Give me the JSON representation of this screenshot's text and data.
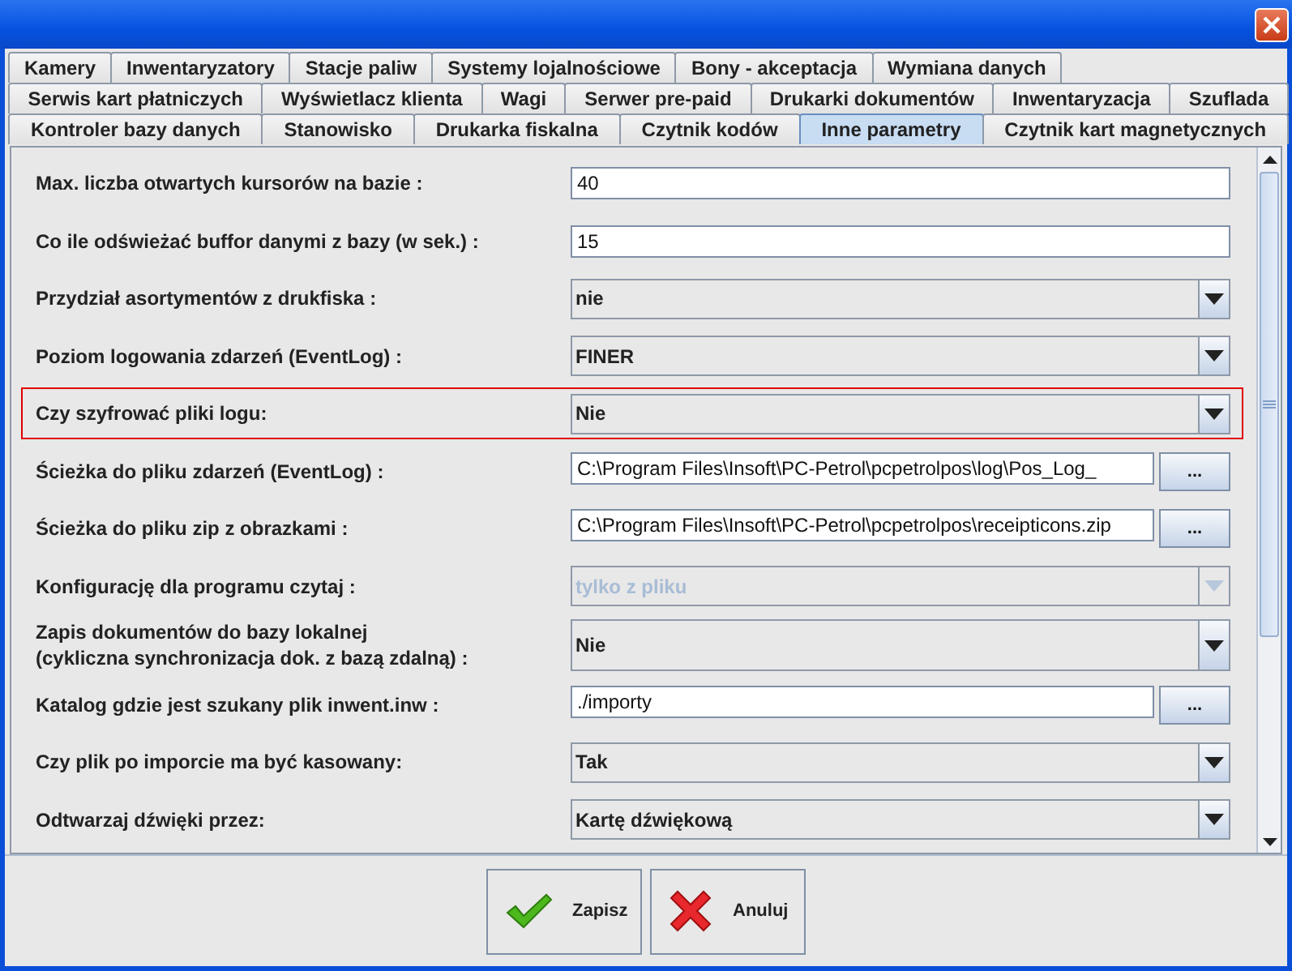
{
  "tab_rows": [
    [
      {
        "label": "Kamery",
        "selected": false
      },
      {
        "label": "Inwentaryzatory",
        "selected": false
      },
      {
        "label": "Stacje paliw",
        "selected": false
      },
      {
        "label": "Systemy lojalnościowe",
        "selected": false
      },
      {
        "label": "Bony - akceptacja",
        "selected": false
      },
      {
        "label": "Wymiana danych",
        "selected": false
      }
    ],
    [
      {
        "label": "Serwis kart płatniczych",
        "selected": false
      },
      {
        "label": "Wyświetlacz klienta",
        "selected": false
      },
      {
        "label": "Wagi",
        "selected": false
      },
      {
        "label": "Serwer pre-paid",
        "selected": false
      },
      {
        "label": "Drukarki dokumentów",
        "selected": false
      },
      {
        "label": "Inwentaryzacja",
        "selected": false
      },
      {
        "label": "Szuflada",
        "selected": false
      }
    ],
    [
      {
        "label": "Kontroler bazy danych",
        "selected": false
      },
      {
        "label": "Stanowisko",
        "selected": false
      },
      {
        "label": "Drukarka fiskalna",
        "selected": false
      },
      {
        "label": "Czytnik kodów",
        "selected": false
      },
      {
        "label": "Inne parametry",
        "selected": true
      },
      {
        "label": "Czytnik kart magnetycznych",
        "selected": false
      }
    ]
  ],
  "settings": [
    {
      "kind": "text",
      "label": "Max. liczba otwartych kursorów na bazie :",
      "value": "40",
      "focused": false
    },
    {
      "kind": "text",
      "label": "Co ile odświeżać buffor danymi z bazy (w sek.) :",
      "value": "15",
      "focused": false
    },
    {
      "kind": "combo",
      "label": "Przydział asortymentów z drukfiska :",
      "value": "nie",
      "disabled": false,
      "focused": false
    },
    {
      "kind": "combo",
      "label": "Poziom logowania zdarzeń (EventLog) :",
      "value": "FINER",
      "disabled": false,
      "focused": false
    },
    {
      "kind": "combo",
      "label": "Czy szyfrować pliki logu:",
      "value": "Nie",
      "disabled": false,
      "focused": true
    },
    {
      "kind": "path",
      "label": "Ścieżka do pliku zdarzeń (EventLog) :",
      "value": "C:\\Program Files\\Insoft\\PC-Petrol\\pcpetrolpos\\log\\Pos_Log_",
      "button": "...",
      "focused": false
    },
    {
      "kind": "path",
      "label": "Ścieżka do pliku zip z obrazkami :",
      "value": "C:\\Program Files\\Insoft\\PC-Petrol\\pcpetrolpos\\receipticons.zip",
      "button": "...",
      "focused": false
    },
    {
      "kind": "combo",
      "label": "Konfigurację dla programu czytaj :",
      "value": "tylko z pliku",
      "disabled": true,
      "focused": false
    },
    {
      "kind": "combo",
      "label": "Zapis dokumentów do bazy lokalnej\n(cykliczna synchronizacja dok. z bazą zdalną) :",
      "value": "Nie",
      "disabled": false,
      "focused": false
    },
    {
      "kind": "path",
      "label": "Katalog gdzie jest szukany plik inwent.inw :",
      "value": "./importy",
      "button": "...",
      "focused": false
    },
    {
      "kind": "combo",
      "label": "Czy plik po imporcie ma być kasowany:",
      "value": "Tak",
      "disabled": false,
      "focused": false
    },
    {
      "kind": "combo",
      "label": "Odtwarzaj dźwięki przez:",
      "value": "Kartę dźwiękową",
      "disabled": false,
      "focused": false
    }
  ],
  "buttons": [
    {
      "kind": "save",
      "label": "Zapisz"
    },
    {
      "kind": "cancel",
      "label": "Anuluj"
    }
  ]
}
